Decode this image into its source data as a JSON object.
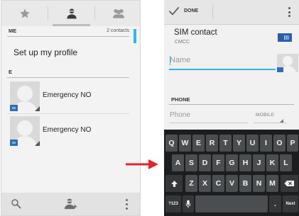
{
  "left_screen": {
    "tabs": [
      {
        "name": "favorites",
        "icon": "star-icon"
      },
      {
        "name": "contacts",
        "icon": "person-icon",
        "active": true
      },
      {
        "name": "groups",
        "icon": "group-icon"
      }
    ],
    "me_section": {
      "label": "ME",
      "count": "2 contacts"
    },
    "setup_profile": "Set up my profile",
    "e_section": {
      "label": "E"
    },
    "contacts": [
      {
        "name": "Emergency NO"
      },
      {
        "name": "Emergency NO"
      }
    ],
    "bottom_bar": [
      "search-icon",
      "add-contact-icon",
      "more-options-icon"
    ]
  },
  "arrow": {
    "color": "#e0252b"
  },
  "right_screen": {
    "done_label": "DONE",
    "account": {
      "title": "SIM contact",
      "subtitle": "CMCC"
    },
    "name_placeholder": "Name",
    "phone_section": "PHONE",
    "phone_placeholder": "Phone",
    "phone_type": "MOBILE"
  },
  "keyboard": {
    "row1": [
      "Q",
      "W",
      "E",
      "R",
      "T",
      "Y",
      "U",
      "I",
      "O",
      "P"
    ],
    "row2": [
      "A",
      "S",
      "D",
      "F",
      "G",
      "H",
      "J",
      "K",
      "L"
    ],
    "row3": [
      "Z",
      "X",
      "C",
      "V",
      "B",
      "N",
      "M"
    ],
    "symbols_key": "?123",
    "period_key": ".",
    "next_key": "Next"
  },
  "colors": {
    "accent": "#33b5e5",
    "keyboard_bg": "#1b1d1e",
    "key": "#4b4e50",
    "sim_badge": "#2a5ea8"
  }
}
